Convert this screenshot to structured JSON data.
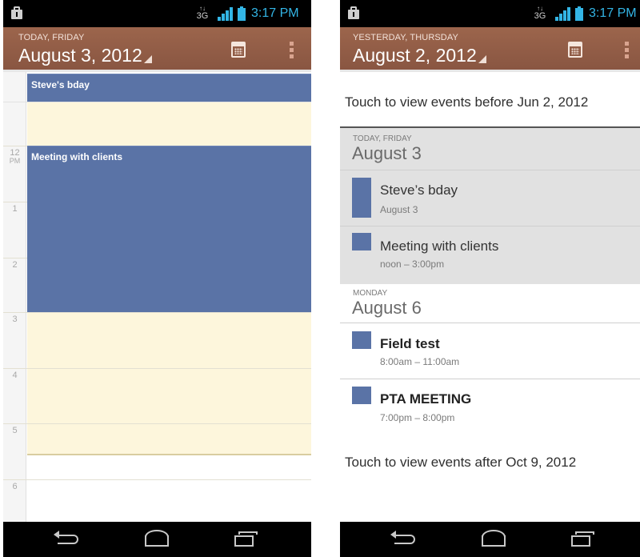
{
  "status_bar": {
    "network_type": "3G",
    "time": "3:17 PM",
    "icon_color": "#33b5e5"
  },
  "left": {
    "header": {
      "subtitle": "TODAY, FRIDAY",
      "date": "August 3, 2012",
      "calendar_button": "calendar-today-icon",
      "overflow_button": "overflow-menu-icon",
      "color": "#8f5a45"
    },
    "hours": [
      {
        "hour": "12",
        "ampm": "PM"
      },
      {
        "hour": "1",
        "ampm": ""
      },
      {
        "hour": "2",
        "ampm": ""
      },
      {
        "hour": "3",
        "ampm": ""
      },
      {
        "hour": "4",
        "ampm": ""
      },
      {
        "hour": "5",
        "ampm": ""
      },
      {
        "hour": "6",
        "ampm": ""
      }
    ],
    "events": [
      {
        "title": "Steve's bday",
        "all_day": true
      },
      {
        "title": "Meeting with clients",
        "all_day": false
      }
    ],
    "event_color": "#5a73a6",
    "working_hours_color": "#fdf6dc"
  },
  "right": {
    "header": {
      "subtitle": "YESTERDAY, THURSDAY",
      "date": "August 2, 2012"
    },
    "load_earlier": "Touch to view events before Jun 2, 2012",
    "days": [
      {
        "subtitle": "TODAY, FRIDAY",
        "date": "August 3",
        "events": [
          {
            "title": "Steve’s bday",
            "detail": "August 3"
          },
          {
            "title": "Meeting with clients",
            "detail": "noon – 3:00pm"
          }
        ]
      },
      {
        "subtitle": "MONDAY",
        "date": "August 6",
        "events": [
          {
            "title": "Field test",
            "detail": "8:00am – 11:00am"
          },
          {
            "title": "PTA MEETING",
            "detail": "7:00pm – 8:00pm"
          }
        ]
      }
    ],
    "load_later": "Touch to view events after Oct 9, 2012"
  },
  "nav_bar": {
    "buttons": [
      "back-icon",
      "home-icon",
      "recent-apps-icon"
    ]
  }
}
